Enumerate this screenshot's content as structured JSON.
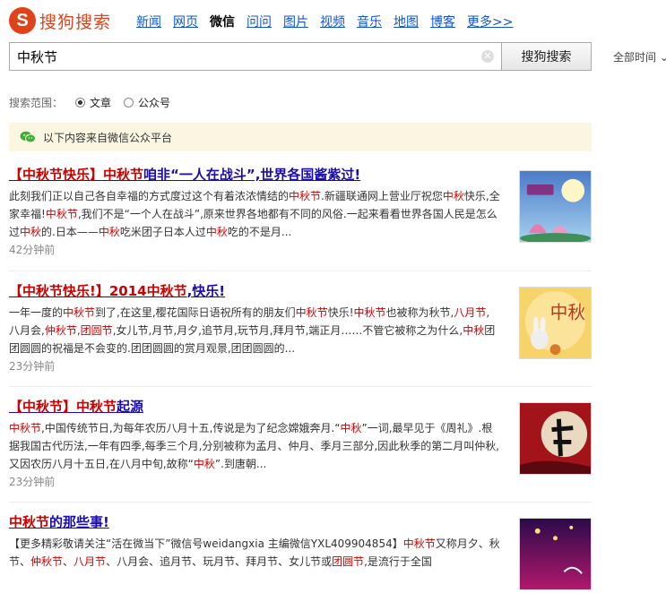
{
  "logo": {
    "mark": "S",
    "text": "搜狗搜索"
  },
  "nav": [
    "新闻",
    "网页",
    "微信",
    "问问",
    "图片",
    "视频",
    "音乐",
    "地图",
    "博客",
    "更多>>"
  ],
  "nav_active": 2,
  "search": {
    "value": "中秋节",
    "button": "搜狗搜索",
    "time_filter": "全部时间 ⌄"
  },
  "scope": {
    "label": "搜索范围：",
    "options": [
      "文章",
      "公众号"
    ],
    "selected": 0
  },
  "notice": {
    "text": "以下内容来自微信公众平台"
  },
  "colors": {
    "brand": "#e0431a",
    "keyword": "#cc0000",
    "link": "#1a0dab"
  },
  "results": [
    {
      "title": [
        [
          "【中秋节快乐】中秋节",
          1
        ],
        [
          "咱非“一人在战斗”,世界各国酱紫过!",
          0
        ]
      ],
      "desc": [
        [
          "此刻我们正以自己各自幸福的方式度过这个有着浓浓情结的",
          0
        ],
        [
          "中秋节",
          1
        ],
        [
          ".新疆联通网上营业厅祝您",
          0
        ],
        [
          "中秋",
          1
        ],
        [
          "快乐,全家幸福!",
          0
        ],
        [
          "中秋节",
          1
        ],
        [
          ",我们不是“一个人在战斗”,原来世界各地都有不同的风俗.一起来看看世界各国人民是怎么过",
          0
        ],
        [
          "中秋",
          1
        ],
        [
          "的.日本——",
          0
        ],
        [
          "中秋",
          1
        ],
        [
          "吃米团子日本人过",
          0
        ],
        [
          "中秋",
          1
        ],
        [
          "吃的不是月...",
          0
        ]
      ],
      "time": "42分钟前",
      "thumb": "moon-lotus-image"
    },
    {
      "title": [
        [
          "【中秋节快乐!】2014中秋节",
          1
        ],
        [
          ",快乐!",
          0
        ]
      ],
      "desc": [
        [
          "一年一度的",
          0
        ],
        [
          "中秋节",
          1
        ],
        [
          "到了,在这里,樱花国际日语祝所有的朋友们",
          0
        ],
        [
          "中秋节",
          1
        ],
        [
          "快乐!",
          0
        ],
        [
          "中秋节",
          1
        ],
        [
          "也被称为秋节,",
          0
        ],
        [
          "八月节",
          1
        ],
        [
          ",八月会,",
          0
        ],
        [
          "仲秋节",
          1
        ],
        [
          ",",
          0
        ],
        [
          "团圆节",
          1
        ],
        [
          ",女儿节,月节,月夕,追节月,玩节月,拜月节,端正月……不管它被称之为什么,",
          0
        ],
        [
          "中秋",
          1
        ],
        [
          "团团圆圆的祝福是不会变的.团团圆圆的赏月观景,团团圆圆的...",
          0
        ]
      ],
      "time": "23分钟前",
      "thumb": "rabbit-moon-image"
    },
    {
      "title": [
        [
          "【中秋节】中秋节",
          1
        ],
        [
          "起源",
          0
        ]
      ],
      "desc": [
        [
          "中秋节",
          1
        ],
        [
          ",中国传统节日,为每年农历八月十五,传说是为了纪念嫦娥奔月.“",
          0
        ],
        [
          "中秋",
          1
        ],
        [
          "”一词,最早见于《周礼》.根据我国古代历法,一年有四季,每季三个月,分别被称为孟月、仲月、季月三部分,因此秋季的第二月叫仲秋,又因农历八月十五日,在八月中旬,故称“",
          0
        ],
        [
          "中秋",
          1
        ],
        [
          "”.到唐朝...",
          0
        ]
      ],
      "time": "23分钟前",
      "thumb": "red-calligraphy-image"
    },
    {
      "title": [
        [
          "中秋节",
          1
        ],
        [
          "的那些事!",
          0
        ]
      ],
      "desc": [
        [
          "【更多精彩敬请关注“活在微当下”微信号weidangxia 主编微信YXL409904854】",
          0
        ],
        [
          "中秋节",
          1
        ],
        [
          "又称月夕、秋节、",
          0
        ],
        [
          "仲秋节",
          1
        ],
        [
          "、",
          0
        ],
        [
          "八月节",
          1
        ],
        [
          "、八月会、追月节、玩月节、拜月节、女儿节或",
          0
        ],
        [
          "团圆节",
          1
        ],
        [
          ",是流行于全国",
          0
        ]
      ],
      "time": "",
      "thumb": "purple-night-image"
    }
  ]
}
